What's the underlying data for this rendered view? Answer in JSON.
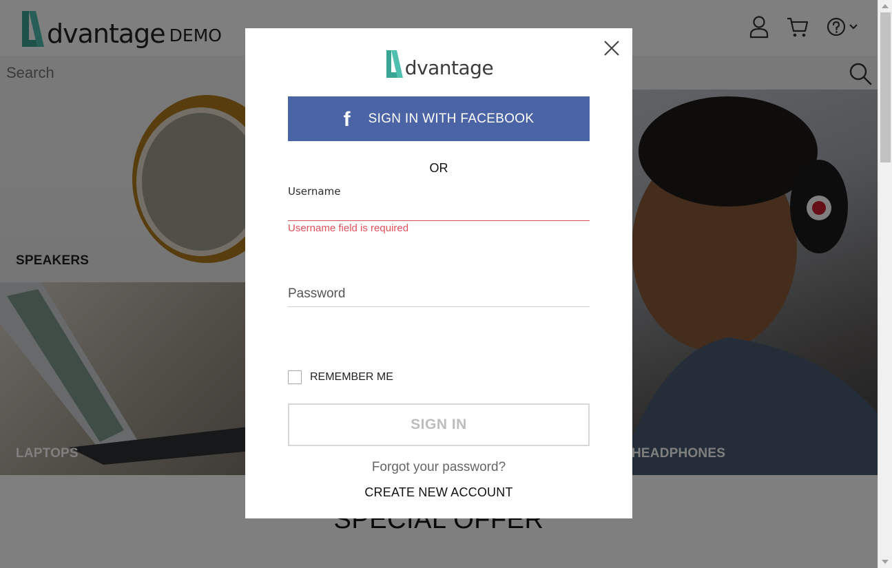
{
  "header": {
    "logo_word": "dvantage",
    "logo_suffix": "DEMO",
    "icons": [
      "user-icon",
      "cart-icon",
      "help-icon",
      "chevron-down-icon"
    ]
  },
  "search": {
    "placeholder": "Search"
  },
  "categories": [
    {
      "label": "SPEAKERS"
    },
    {
      "label": "LAPTOPS"
    },
    {
      "label": "HEADPHONES"
    }
  ],
  "special_offer": {
    "title": "SPECIAL OFFER"
  },
  "login_modal": {
    "logo_word": "dvantage",
    "facebook_label": "SIGN IN WITH FACEBOOK",
    "facebook_icon": "f",
    "or_label": "OR",
    "username_label": "Username",
    "username_value": "",
    "username_error": "Username field is required",
    "password_placeholder": "Password",
    "remember_label": "REMEMBER ME",
    "remember_checked": false,
    "signin_label": "SIGN IN",
    "forgot_label": "Forgot your password?",
    "create_label": "CREATE NEW ACCOUNT"
  },
  "colors": {
    "brand_teal": "#4fb3a5",
    "facebook_blue": "#4a64a6",
    "error_red": "#e0505c"
  }
}
